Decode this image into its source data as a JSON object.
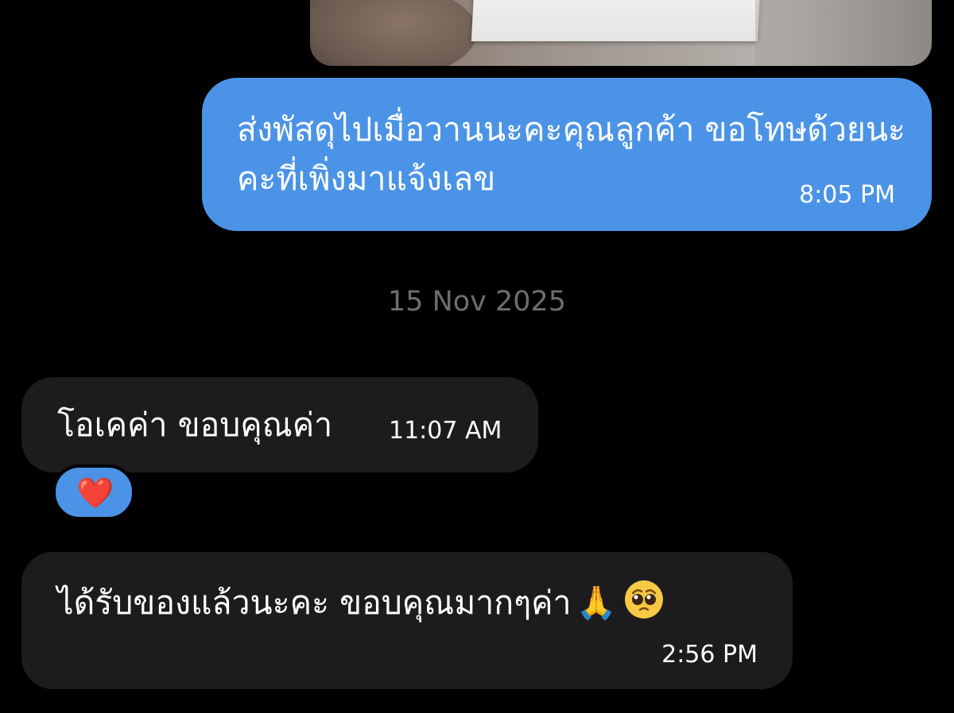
{
  "conversation": {
    "photo": {
      "icon": "photo-attachment",
      "printed_text": "..."
    },
    "outgoing_message": {
      "text": "ส่งพัสดุไปเมื่อวานนะคะคุณลูกค้า ขอโทษด้วยนะคะที่เพิ่งมาแจ้งเลข",
      "time": "8:05 PM",
      "color": "#4b93e6"
    },
    "date_separator": "15 Nov 2025",
    "incoming_messages": [
      {
        "text": "โอเคค่า ขอบคุณค่า",
        "time": "11:07 AM",
        "reaction": "❤️"
      },
      {
        "text": "ได้รับของแล้วนะคะ ขอบคุณมากๆค่า",
        "emojis": [
          "🙏",
          "🥺"
        ],
        "time": "2:56 PM"
      }
    ],
    "colors": {
      "background": "#000000",
      "incoming_bubble": "#1c1c1e",
      "outgoing_bubble": "#4b93e6",
      "date_text": "#6d6e72"
    }
  }
}
